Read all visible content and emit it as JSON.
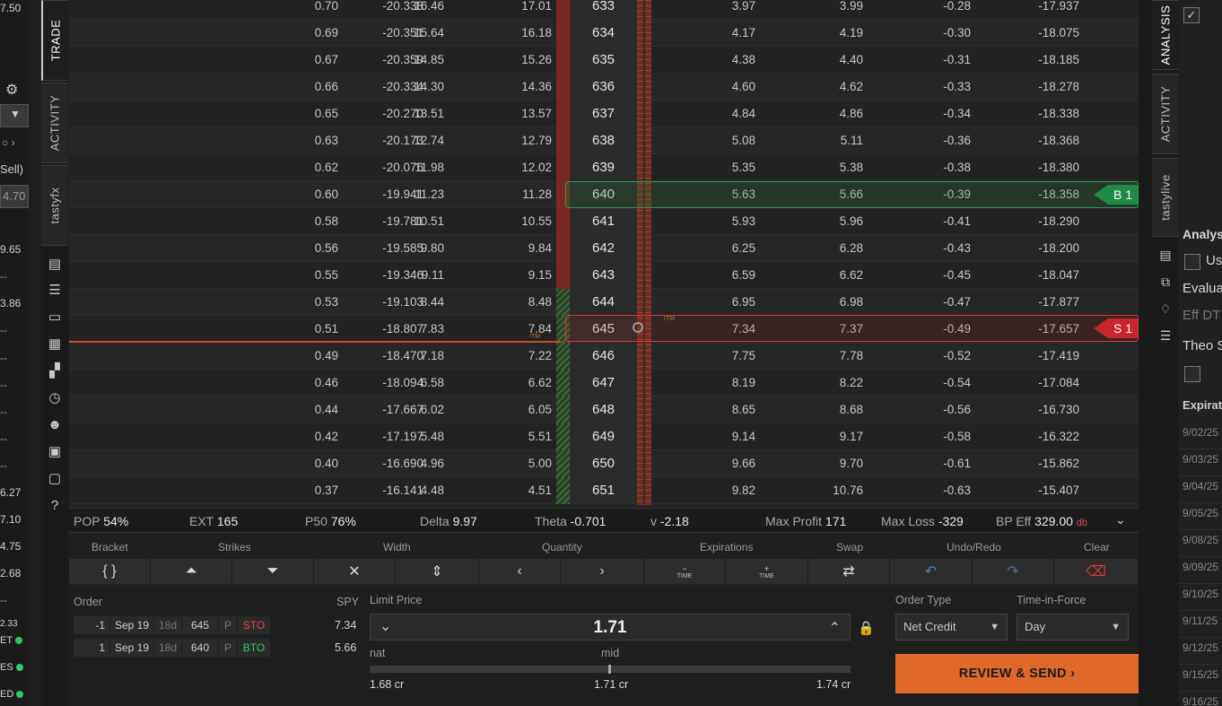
{
  "left_sidebar": {
    "top_value": "7.50",
    "sell_label": "Sell)",
    "field_value": "4.70",
    "values": [
      "9.65",
      "--",
      "3.86",
      "--",
      "--",
      "--",
      "--",
      "--",
      "--",
      "6.27",
      "7.10",
      "4.75",
      "2.68",
      "--",
      "2.33"
    ],
    "status": [
      "ET",
      "ES",
      "ED"
    ]
  },
  "left_tabs": [
    "TRADE",
    "ACTIVITY",
    "tastyfx"
  ],
  "chain_rows": [
    {
      "c1": "-20.338",
      "c2": "0.70",
      "c3": "16.46",
      "c4": "17.01",
      "strike": "633",
      "c5": "3.97",
      "c6": "3.99",
      "c7": "-0.28",
      "c8": "-17.937"
    },
    {
      "c1": "-20.351",
      "c2": "0.69",
      "c3": "15.64",
      "c4": "16.18",
      "strike": "634",
      "c5": "4.17",
      "c6": "4.19",
      "c7": "-0.30",
      "c8": "-18.075"
    },
    {
      "c1": "-20.359",
      "c2": "0.67",
      "c3": "14.85",
      "c4": "15.26",
      "strike": "635",
      "c5": "4.38",
      "c6": "4.40",
      "c7": "-0.31",
      "c8": "-18.185"
    },
    {
      "c1": "-20.334",
      "c2": "0.66",
      "c3": "14.30",
      "c4": "14.36",
      "strike": "636",
      "c5": "4.60",
      "c6": "4.62",
      "c7": "-0.33",
      "c8": "-18.278"
    },
    {
      "c1": "-20.270",
      "c2": "0.65",
      "c3": "13.51",
      "c4": "13.57",
      "strike": "637",
      "c5": "4.84",
      "c6": "4.86",
      "c7": "-0.34",
      "c8": "-18.338"
    },
    {
      "c1": "-20.173",
      "c2": "0.63",
      "c3": "12.74",
      "c4": "12.79",
      "strike": "638",
      "c5": "5.08",
      "c6": "5.11",
      "c7": "-0.36",
      "c8": "-18.368"
    },
    {
      "c1": "-20.076",
      "c2": "0.62",
      "c3": "11.98",
      "c4": "12.02",
      "strike": "639",
      "c5": "5.35",
      "c6": "5.38",
      "c7": "-0.38",
      "c8": "-18.380"
    },
    {
      "c1": "-19.941",
      "c2": "0.60",
      "c3": "11.23",
      "c4": "11.28",
      "strike": "640",
      "c5": "5.63",
      "c6": "5.66",
      "c7": "-0.39",
      "c8": "-18.358"
    },
    {
      "c1": "-19.781",
      "c2": "0.58",
      "c3": "10.51",
      "c4": "10.55",
      "strike": "641",
      "c5": "5.93",
      "c6": "5.96",
      "c7": "-0.41",
      "c8": "-18.290"
    },
    {
      "c1": "-19.585",
      "c2": "0.56",
      "c3": "9.80",
      "c4": "9.84",
      "strike": "642",
      "c5": "6.25",
      "c6": "6.28",
      "c7": "-0.43",
      "c8": "-18.200"
    },
    {
      "c1": "-19.346",
      "c2": "0.55",
      "c3": "9.11",
      "c4": "9.15",
      "strike": "643",
      "c5": "6.59",
      "c6": "6.62",
      "c7": "-0.45",
      "c8": "-18.047"
    },
    {
      "c1": "-19.103",
      "c2": "0.53",
      "c3": "8.44",
      "c4": "8.48",
      "strike": "644",
      "c5": "6.95",
      "c6": "6.98",
      "c7": "-0.47",
      "c8": "-17.877"
    },
    {
      "c1": "-18.807",
      "c2": "0.51",
      "c3": "7.83",
      "c4": "7.84",
      "strike": "645",
      "c5": "7.34",
      "c6": "7.37",
      "c7": "-0.49",
      "c8": "-17.657"
    },
    {
      "c1": "-18.470",
      "c2": "0.49",
      "c3": "7.18",
      "c4": "7.22",
      "strike": "646",
      "c5": "7.75",
      "c6": "7.78",
      "c7": "-0.52",
      "c8": "-17.419"
    },
    {
      "c1": "-18.094",
      "c2": "0.46",
      "c3": "6.58",
      "c4": "6.62",
      "strike": "647",
      "c5": "8.19",
      "c6": "8.22",
      "c7": "-0.54",
      "c8": "-17.084"
    },
    {
      "c1": "-17.667",
      "c2": "0.44",
      "c3": "6.02",
      "c4": "6.05",
      "strike": "648",
      "c5": "8.65",
      "c6": "8.68",
      "c7": "-0.56",
      "c8": "-16.730"
    },
    {
      "c1": "-17.197",
      "c2": "0.42",
      "c3": "5.48",
      "c4": "5.51",
      "strike": "649",
      "c5": "9.14",
      "c6": "9.17",
      "c7": "-0.58",
      "c8": "-16.322"
    },
    {
      "c1": "-16.690",
      "c2": "0.40",
      "c3": "4.96",
      "c4": "5.00",
      "strike": "650",
      "c5": "9.66",
      "c6": "9.70",
      "c7": "-0.61",
      "c8": "-15.862"
    },
    {
      "c1": "-16.141",
      "c2": "0.37",
      "c3": "4.48",
      "c4": "4.51",
      "strike": "651",
      "c5": "9.82",
      "c6": "10.76",
      "c7": "-0.63",
      "c8": "-15.407"
    }
  ],
  "markers": {
    "buy": "B 1",
    "sell": "S 1",
    "itm": "ITM"
  },
  "stats": {
    "pop_label": "POP",
    "pop": "54%",
    "ext_label": "EXT",
    "ext": "165",
    "p50_label": "P50",
    "p50": "76%",
    "delta_label": "Delta",
    "delta": "9.97",
    "theta_label": "Theta",
    "theta": "-0.701",
    "vega_label": "v",
    "vega": "-2.18",
    "maxprofit_label": "Max Profit",
    "maxprofit": "171",
    "maxloss_label": "Max Loss",
    "maxloss": "-329",
    "bpeff_label": "BP Eff",
    "bpeff": "329.00",
    "bpeff_suffix": "db"
  },
  "toolbar": {
    "labels": [
      "Bracket",
      "Strikes",
      "Width",
      "Quantity",
      "Expirations",
      "Swap",
      "Undo/Redo",
      "Clear"
    ],
    "time_label": "TIME"
  },
  "order": {
    "order_label": "Order",
    "symbol": "SPY",
    "legs": [
      {
        "qty": "-1",
        "exp": "Sep 19",
        "dte": "18d",
        "strike": "645",
        "type": "P",
        "action": "STO",
        "price": "7.34"
      },
      {
        "qty": "1",
        "exp": "Sep 19",
        "dte": "18d",
        "strike": "640",
        "type": "P",
        "action": "BTO",
        "price": "5.66"
      }
    ],
    "limit_label": "Limit Price",
    "limit_price": "1.71",
    "nat_label": "nat",
    "mid_label": "mid",
    "nat_value": "1.68 cr",
    "mid_value": "1.71 cr",
    "far_value": "1.74 cr",
    "order_type_label": "Order Type",
    "order_type": "Net Credit",
    "tif_label": "Time-in-Force",
    "tif": "Day",
    "review_button": "REVIEW & SEND"
  },
  "right_tabs": [
    "ANALYSIS",
    "ACTIVITY",
    "tastylive"
  ],
  "right_panel": {
    "analysis": "Analysis",
    "use": "Us",
    "evaluate": "Evalua",
    "effdt": "Eff DT",
    "theo": "Theo S",
    "expirations": "Expiratio",
    "dates": [
      "9/02/25",
      "9/03/25",
      "9/04/25",
      "9/05/25",
      "9/08/25",
      "9/09/25",
      "9/10/25",
      "9/11/25",
      "9/12/25",
      "9/15/25",
      "9/16/25"
    ]
  },
  "colors": {
    "accent": "#e0692a",
    "buy": "#1f8a44",
    "sell": "#c8262a",
    "sto": "#e04a4a",
    "bto": "#2ec866"
  }
}
